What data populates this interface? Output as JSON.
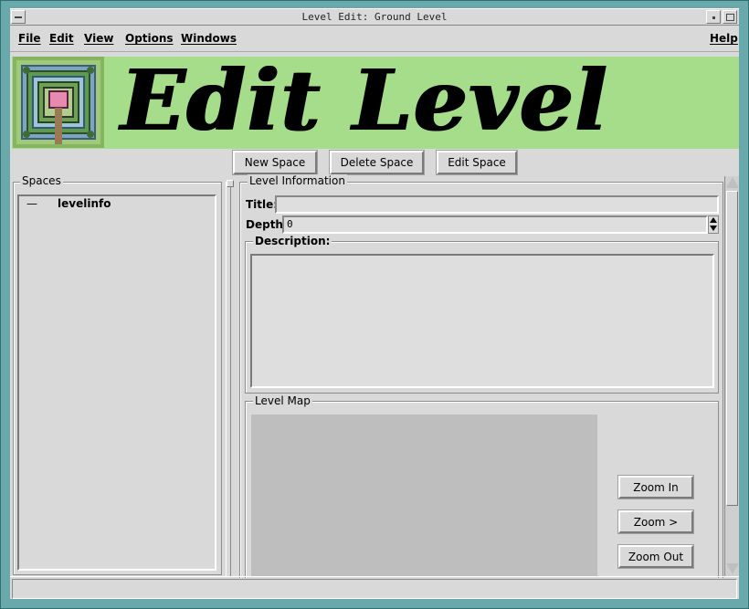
{
  "window": {
    "title": "Level Edit: Ground Level"
  },
  "menubar": {
    "file": "File",
    "edit": "Edit",
    "view": "View",
    "options": "Options",
    "windows": "Windows",
    "help": "Help"
  },
  "banner": {
    "heading": "Edit Level"
  },
  "toolbar": {
    "new_space": "New Space",
    "delete_space": "Delete Space",
    "edit_space": "Edit Space"
  },
  "spaces": {
    "label": "Spaces",
    "items": [
      {
        "marker": "—",
        "label": "levelinfo"
      }
    ]
  },
  "level_info": {
    "label": "Level Information",
    "title_label": "Title:",
    "title_value": "",
    "depth_label": "Depth:",
    "depth_value": "0",
    "description_label": "Description:",
    "description_value": ""
  },
  "level_map": {
    "label": "Level Map",
    "zoom_in": "Zoom In",
    "zoom_more": "Zoom >",
    "zoom_out": "Zoom Out"
  },
  "colors": {
    "desktop": "#5f9ea0",
    "window_bg": "#d9d9d9",
    "banner_bg": "#a6dd8a",
    "map_bg": "#bebebe"
  }
}
